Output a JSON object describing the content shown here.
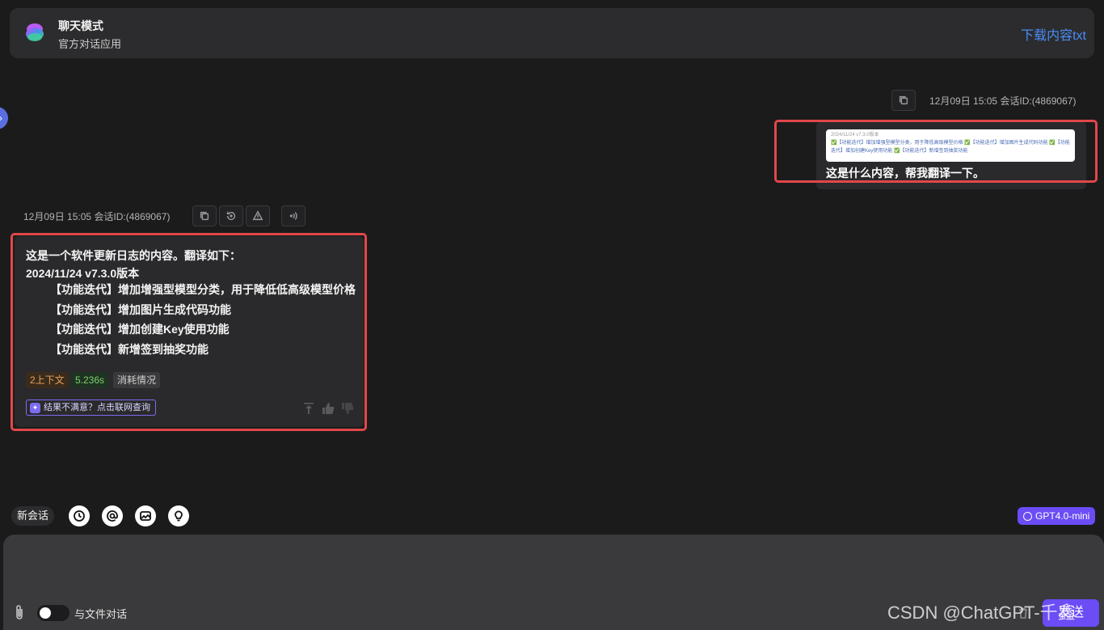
{
  "header": {
    "title": "聊天模式",
    "subtitle": "官方对话应用",
    "download_label": "下载内容txt"
  },
  "user_message": {
    "meta": "12月09日 15:05 会话ID:(4869067)",
    "thumbnail_line1": "2024/11/24 v7.3.0版本",
    "thumbnail_line2": "✅【功能迭代】增加增强型模型分类，用于降低高级模型价格 ✅【功能迭代】增加图片生成代码功能 ✅【功能迭代】增加创建Key使用功能 ✅【功能迭代】新增签到抽奖功能",
    "text": "这是什么内容，帮我翻译一下。"
  },
  "bot_message": {
    "meta": "12月09日 15:05 会话ID:(4869067)",
    "lines": [
      "这是一个软件更新日志的内容。翻译如下：",
      "2024/11/24 v7.3.0版本",
      "【功能迭代】增加增强型模型分类，用于降低低高级模型价格",
      "【功能迭代】增加图片生成代码功能",
      "【功能迭代】增加创建Key使用功能",
      "【功能迭代】新增签到抽奖功能"
    ],
    "tag_context": "2上下文",
    "tag_time": "5.236s",
    "tag_cost": "消耗情况",
    "not_satisfied": "结果不满意？点击联网查询"
  },
  "toolbar": {
    "new_chat": "新会话",
    "model": "GPT4.0-mini"
  },
  "input": {
    "file_toggle_label": "与文件对话",
    "send_label": "发送"
  },
  "watermark": "CSDN @ChatGPT-千鑫",
  "colors": {
    "accent": "#6b4cf5",
    "link": "#4a8cf7",
    "highlight": "#e2474a"
  }
}
